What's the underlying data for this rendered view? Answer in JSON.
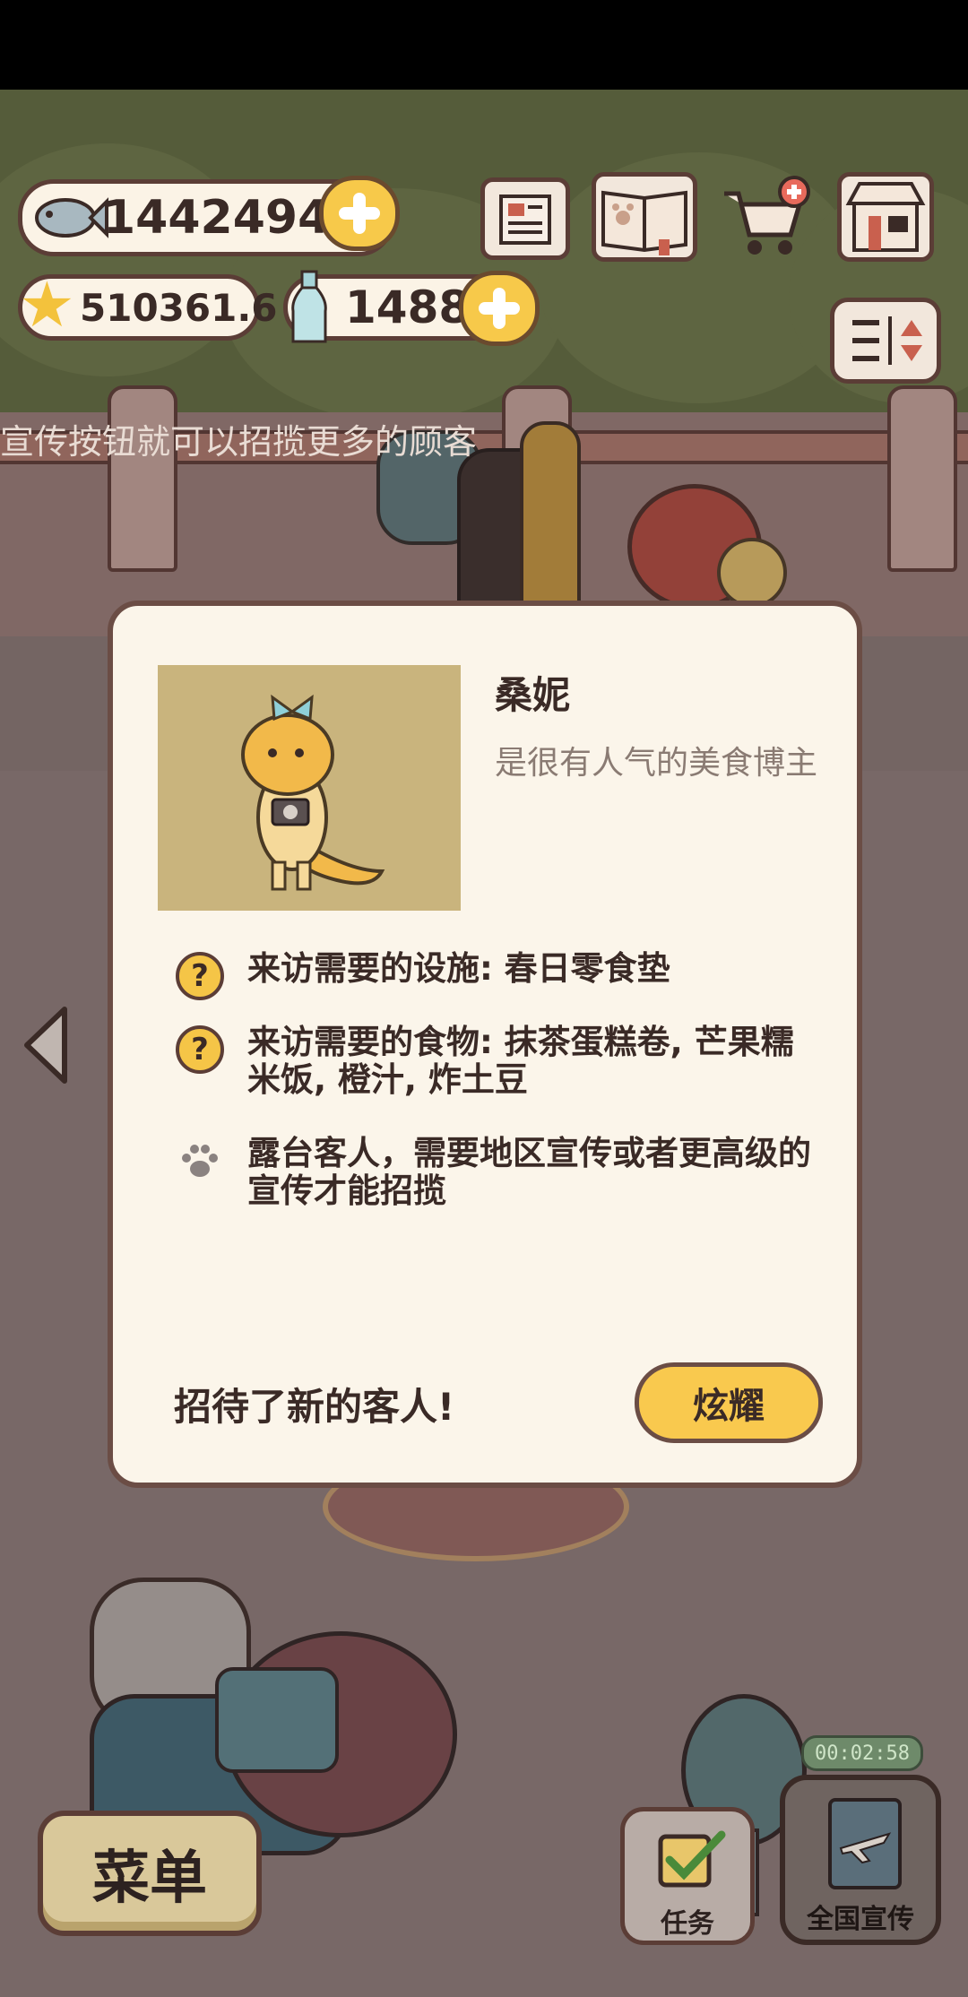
{
  "currency": {
    "fish": "14424940",
    "stars": "510361.6",
    "bottles": "1488"
  },
  "marquee": "宣传按钮就可以招揽更多的顾客",
  "dialog": {
    "name": "桑妮",
    "subtitle": "是很有人气的美食博主",
    "requirements": [
      {
        "icon": "question-icon",
        "text": "来访需要的设施: 春日零食垫"
      },
      {
        "icon": "question-icon",
        "text": "来访需要的食物: 抹茶蛋糕卷, 芒果糯米饭, 橙汁, 炸土豆"
      },
      {
        "icon": "paw-icon",
        "text": "露台客人，需要地区宣传或者更高级的宣传才能招揽"
      }
    ],
    "footer_message": "招待了新的客人!",
    "show_off_button": "炫耀"
  },
  "bottom": {
    "menu_label": "菜单",
    "task_label": "任务",
    "promo_label": "全国宣传",
    "timer": "00:02:58"
  },
  "colors": {
    "accent_yellow": "#f9c94e",
    "outline_brown": "#5b3d36",
    "dialog_bg": "#fbf5ea"
  }
}
